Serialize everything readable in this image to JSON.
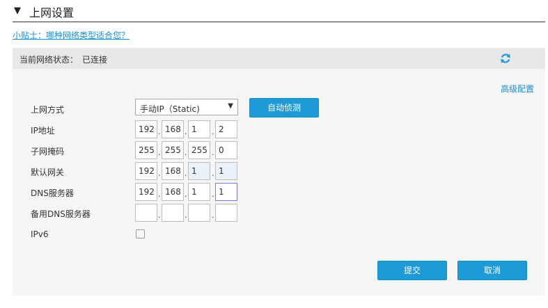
{
  "header": {
    "title": "上网设置"
  },
  "tip": {
    "link_text": "小贴士：哪种网络类型适合您？"
  },
  "status": {
    "label": "当前网络状态：",
    "value": "已连接"
  },
  "advanced_link": "高级配置",
  "form": {
    "wan_mode": {
      "label": "上网方式",
      "value": "手动IP（Static)"
    },
    "auto_detect_label": "自动侦测",
    "ip": {
      "label": "IP地址",
      "octets": [
        "192",
        "168",
        "1",
        "2"
      ]
    },
    "subnet": {
      "label": "子网掩码",
      "octets": [
        "255",
        "255",
        "255",
        "0"
      ]
    },
    "gateway": {
      "label": "默认网关",
      "octets": [
        "192",
        "168",
        "1",
        "1"
      ]
    },
    "dns": {
      "label": "DNS服务器",
      "octets": [
        "192",
        "168",
        "1",
        "1"
      ]
    },
    "dns_alt": {
      "label": "备用DNS服务器",
      "octets": [
        "",
        "",
        "",
        ""
      ]
    },
    "ipv6": {
      "label": "IPv6",
      "checked": false
    }
  },
  "actions": {
    "submit_label": "提交",
    "cancel_label": "取消"
  },
  "colors": {
    "accent": "#1e9ad8",
    "link": "#1a8fd0",
    "panel_bg": "#f6f6f6",
    "status_bg": "#e8e8e8"
  }
}
